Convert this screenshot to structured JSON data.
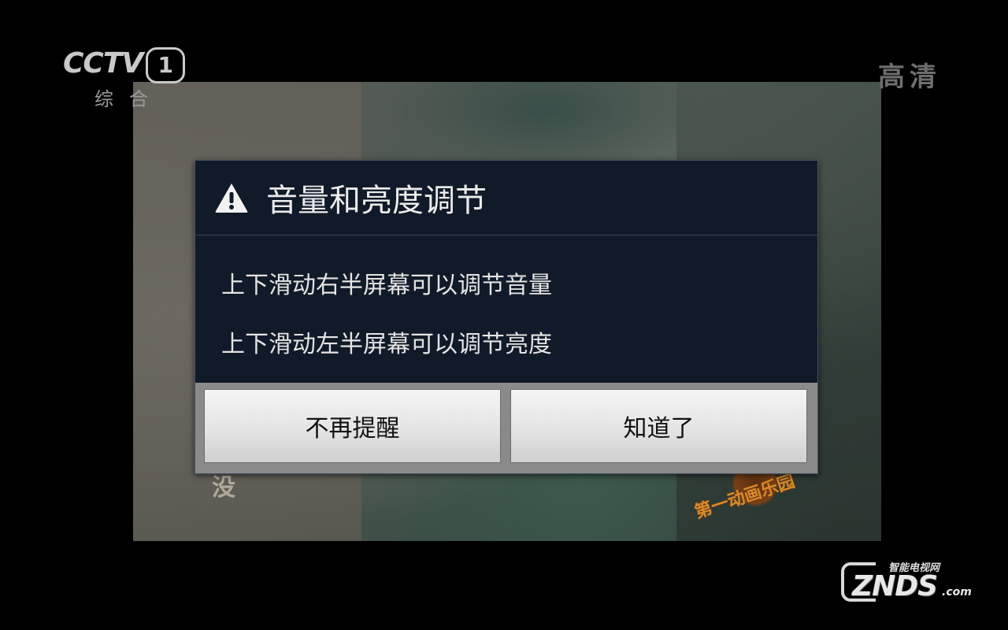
{
  "channel": {
    "logo_text": "CCTV",
    "number": "1",
    "sub_label": "综合",
    "quality_badge": "高清"
  },
  "video": {
    "subtitle_fragment": "没",
    "show_logo_text": "第一动画乐园"
  },
  "dialog": {
    "icon": "warning-triangle-icon",
    "title": "音量和亮度调节",
    "lines": [
      "上下滑动右半屏幕可以调节音量",
      "上下滑动左半屏幕可以调节亮度"
    ],
    "buttons": {
      "dont_remind": "不再提醒",
      "got_it": "知道了"
    }
  },
  "watermark": {
    "top_text": "智能电视网",
    "brand": "ZNDS",
    "suffix": ".com"
  },
  "colors": {
    "dialog_bg": "#111a29",
    "button_bar_bg": "#8a8a8a",
    "button_bg": "#e6e6e6"
  }
}
